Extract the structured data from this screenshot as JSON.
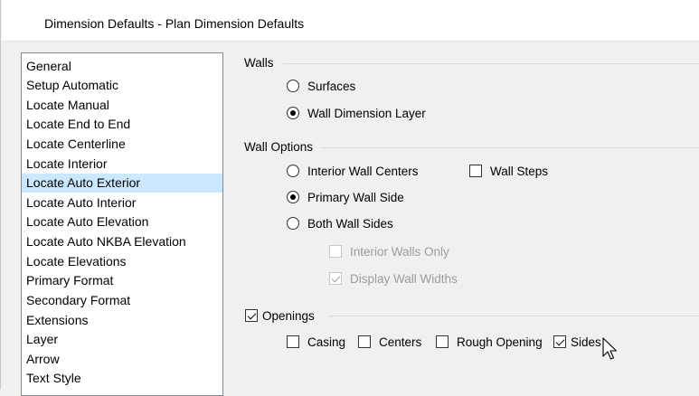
{
  "window": {
    "title": "Dimension Defaults - Plan Dimension Defaults"
  },
  "sidebar": {
    "items": [
      "General",
      "Setup Automatic",
      "Locate Manual",
      "Locate End to End",
      "Locate Centerline",
      "Locate Interior",
      "Locate Auto Exterior",
      "Locate Auto Interior",
      "Locate Auto Elevation",
      "Locate Auto NKBA Elevation",
      "Locate Elevations",
      "Primary Format",
      "Secondary Format",
      "Extensions",
      "Layer",
      "Arrow",
      "Text Style"
    ],
    "selected": "Locate Auto Exterior"
  },
  "walls": {
    "title": "Walls",
    "options": {
      "surfaces": "Surfaces",
      "wall_dimension_layer": "Wall Dimension Layer"
    },
    "selected": "Wall Dimension Layer"
  },
  "wall_options": {
    "title": "Wall Options",
    "interior_wall_centers": "Interior Wall Centers",
    "wall_steps": "Wall Steps",
    "wall_steps_checked": false,
    "primary_wall_side": "Primary Wall Side",
    "both_wall_sides": "Both Wall Sides",
    "selected": "Primary Wall Side",
    "interior_walls_only": {
      "label": "Interior Walls Only",
      "checked": false,
      "enabled": false
    },
    "display_wall_widths": {
      "label": "Display Wall Widths",
      "checked": true,
      "enabled": false
    }
  },
  "openings": {
    "label": "Openings",
    "checked": true,
    "casing": {
      "label": "Casing",
      "checked": false
    },
    "centers": {
      "label": "Centers",
      "checked": false
    },
    "rough_opening": {
      "label": "Rough Opening",
      "checked": false
    },
    "sides": {
      "label": "Sides",
      "checked": true
    }
  },
  "icons": {
    "cursor": "arrow-cursor-icon"
  }
}
